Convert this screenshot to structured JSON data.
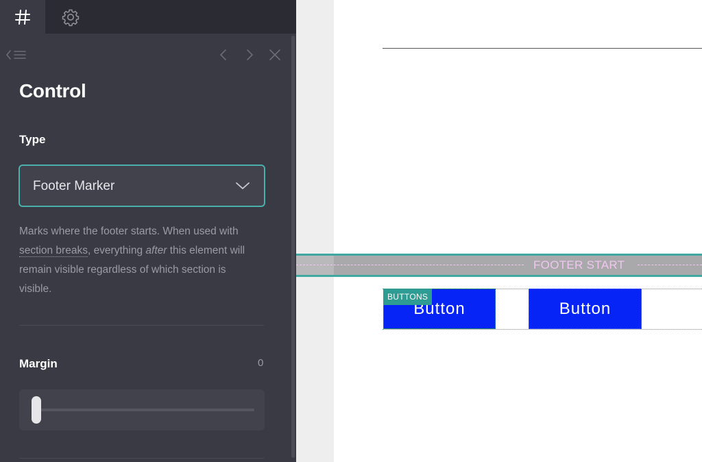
{
  "tabs": {
    "hash_icon": "hash-icon",
    "settings_icon": "gear-icon"
  },
  "nav": {
    "back_icon": "back-list-icon",
    "prev_icon": "chevron-left-icon",
    "next_icon": "chevron-right-icon",
    "close_icon": "close-icon"
  },
  "panel": {
    "title": "Control",
    "type": {
      "label": "Type",
      "selected": "Footer Marker"
    },
    "description": {
      "part1": "Marks where the footer starts. When used with ",
      "link": "section breaks",
      "part2": ", everything ",
      "emphasis": "after",
      "part3": " this element will remain visible regardless of which section is visible."
    },
    "margin": {
      "label": "Margin",
      "value": "0",
      "slider_level": 0
    }
  },
  "canvas": {
    "footer_marker_label": "FOOTER START",
    "buttons_tag": "BUTTONS",
    "button1_label": "Button",
    "button2_label": "Button"
  },
  "colors": {
    "panel_bg": "#393a44",
    "accent_teal": "#4ab0ab",
    "footer_label_pink": "#f0c6ef",
    "button_blue": "#0624f5"
  }
}
